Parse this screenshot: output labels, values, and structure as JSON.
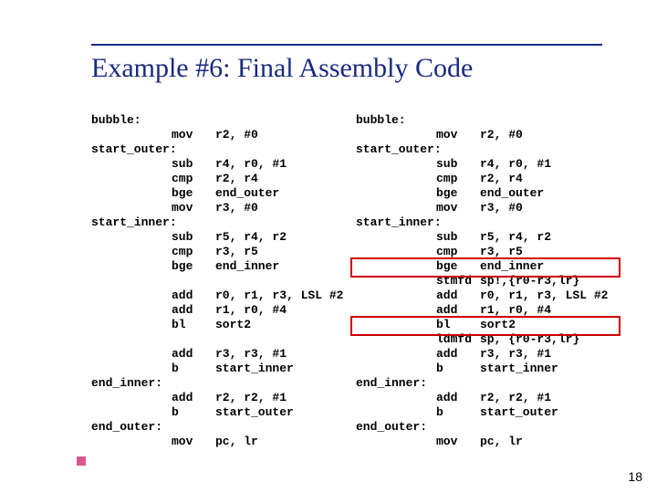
{
  "slide": {
    "title": "Example #6: Final Assembly Code",
    "number": "18"
  },
  "left_code": [
    {
      "label": "bubble:",
      "mn": "",
      "ops": ""
    },
    {
      "label": "",
      "mn": "mov",
      "ops": "r2, #0"
    },
    {
      "label": "start_outer:",
      "mn": "",
      "ops": ""
    },
    {
      "label": "",
      "mn": "sub",
      "ops": "r4, r0, #1"
    },
    {
      "label": "",
      "mn": "cmp",
      "ops": "r2, r4"
    },
    {
      "label": "",
      "mn": "bge",
      "ops": "end_outer"
    },
    {
      "label": "",
      "mn": "mov",
      "ops": "r3, #0"
    },
    {
      "label": "start_inner:",
      "mn": "",
      "ops": ""
    },
    {
      "label": "",
      "mn": "sub",
      "ops": "r5, r4, r2"
    },
    {
      "label": "",
      "mn": "cmp",
      "ops": "r3, r5"
    },
    {
      "label": "",
      "mn": "bge",
      "ops": "end_inner"
    },
    {
      "label": "",
      "mn": "",
      "ops": ""
    },
    {
      "label": "",
      "mn": "add",
      "ops": "r0, r1, r3, LSL #2"
    },
    {
      "label": "",
      "mn": "add",
      "ops": "r1, r0, #4"
    },
    {
      "label": "",
      "mn": "bl",
      "ops": "sort2"
    },
    {
      "label": "",
      "mn": "",
      "ops": ""
    },
    {
      "label": "",
      "mn": "add",
      "ops": "r3, r3, #1"
    },
    {
      "label": "",
      "mn": "b",
      "ops": "start_inner"
    },
    {
      "label": "end_inner:",
      "mn": "",
      "ops": ""
    },
    {
      "label": "",
      "mn": "add",
      "ops": "r2, r2, #1"
    },
    {
      "label": "",
      "mn": "b",
      "ops": "start_outer"
    },
    {
      "label": "end_outer:",
      "mn": "",
      "ops": ""
    },
    {
      "label": "",
      "mn": "mov",
      "ops": "pc, lr"
    }
  ],
  "right_code": [
    {
      "label": "bubble:",
      "mn": "",
      "ops": ""
    },
    {
      "label": "",
      "mn": "mov",
      "ops": "r2, #0"
    },
    {
      "label": "start_outer:",
      "mn": "",
      "ops": ""
    },
    {
      "label": "",
      "mn": "sub",
      "ops": "r4, r0, #1"
    },
    {
      "label": "",
      "mn": "cmp",
      "ops": "r2, r4"
    },
    {
      "label": "",
      "mn": "bge",
      "ops": "end_outer"
    },
    {
      "label": "",
      "mn": "mov",
      "ops": "r3, #0"
    },
    {
      "label": "start_inner:",
      "mn": "",
      "ops": ""
    },
    {
      "label": "",
      "mn": "sub",
      "ops": "r5, r4, r2"
    },
    {
      "label": "",
      "mn": "cmp",
      "ops": "r3, r5"
    },
    {
      "label": "",
      "mn": "bge",
      "ops": "end_inner"
    },
    {
      "label": "",
      "mn": "stmfd",
      "ops": "sp!,{r0-r3,lr}"
    },
    {
      "label": "",
      "mn": "add",
      "ops": "r0, r1, r3, LSL #2"
    },
    {
      "label": "",
      "mn": "add",
      "ops": "r1, r0, #4"
    },
    {
      "label": "",
      "mn": "bl",
      "ops": "sort2"
    },
    {
      "label": "",
      "mn": "ldmfd",
      "ops": "sp, {r0-r3,lr}"
    },
    {
      "label": "",
      "mn": "add",
      "ops": "r3, r3, #1"
    },
    {
      "label": "",
      "mn": "b",
      "ops": "start_inner"
    },
    {
      "label": "end_inner:",
      "mn": "",
      "ops": ""
    },
    {
      "label": "",
      "mn": "add",
      "ops": "r2, r2, #1"
    },
    {
      "label": "",
      "mn": "b",
      "ops": "start_outer"
    },
    {
      "label": "end_outer:",
      "mn": "",
      "ops": ""
    },
    {
      "label": "",
      "mn": "mov",
      "ops": "pc, lr"
    }
  ]
}
